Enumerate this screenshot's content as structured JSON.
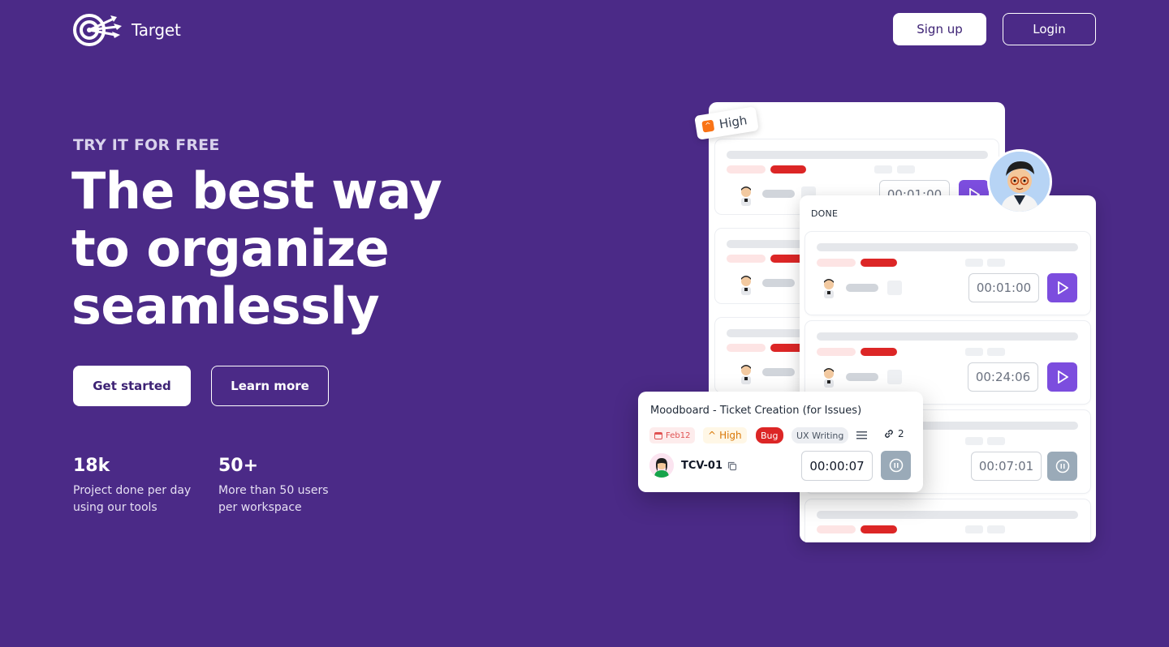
{
  "header": {
    "logo_text": "Target",
    "signup_label": "Sign up",
    "login_label": "Login"
  },
  "hero": {
    "eyebrow": "TRY IT FOR FREE",
    "headline_lines": [
      "The best way",
      "to organize",
      "seamlessly"
    ],
    "get_started_label": "Get started",
    "learn_more_label": "Learn more",
    "stats": [
      {
        "value": "18k",
        "desc_lines": [
          "Project done per day",
          "using our tools"
        ]
      },
      {
        "value": "50+",
        "desc_lines": [
          "More than 50 users",
          "per workspace"
        ]
      }
    ]
  },
  "illustration": {
    "priority_tag": "High",
    "back_card_timer": "00:01:00",
    "done_card": {
      "label": "DONE",
      "timers": [
        "00:01:00",
        "00:24:06",
        "00:07:01"
      ]
    },
    "ticket": {
      "title": "Moodboard - Ticket Creation (for Issues)",
      "date_tag": "Feb12",
      "priority": "High",
      "type_tag": "Bug",
      "category_tag": "UX Writing",
      "link_count": "2",
      "id": "TCV-01",
      "timer": "00:00:07"
    }
  },
  "colors": {
    "background": "#4b2a87",
    "accent_purple": "#7c4dde",
    "danger_red": "#dc2626",
    "priority_orange": "#f97316"
  }
}
